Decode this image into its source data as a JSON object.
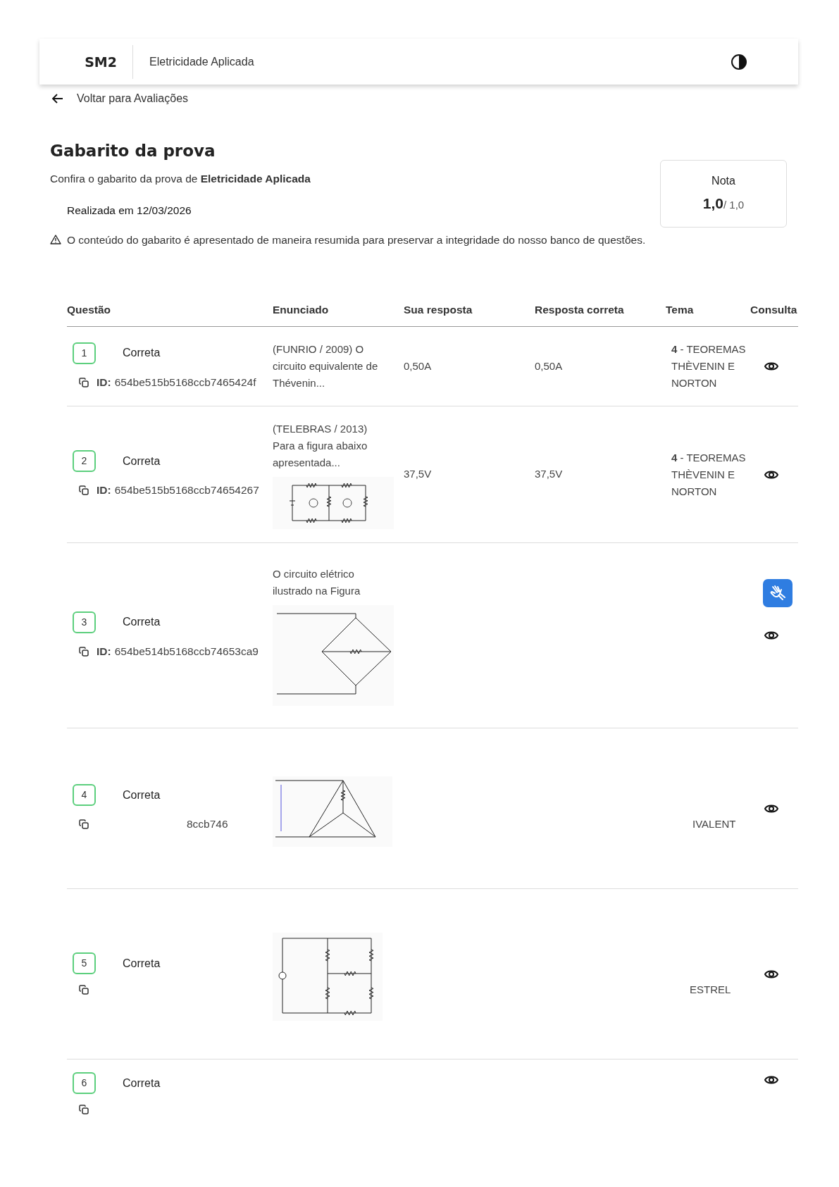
{
  "header": {
    "logo": "SM2",
    "course": "Eletricidade Aplicada"
  },
  "back_link": "Voltar para Avaliações",
  "title": "Gabarito da prova",
  "subtitle": "Confira o gabarito da prova de **Eletricidade Aplicada**",
  "date": "Realizada em 12/03/2026",
  "warning": "O conteúdo do gabarito é apresentado de maneira resumida para preservar a integridade do nosso banco de questões.",
  "grade": {
    "label": "Nota",
    "value": "1,0",
    "max": "/ 1,0"
  },
  "table": {
    "columns": [
      "Questão",
      "Enunciado",
      "Sua resposta",
      "Resposta correta",
      "Tema",
      "Consulta"
    ],
    "rows": [
      {
        "number": "1",
        "status": "Correta",
        "correct": true,
        "id_label": "ID:",
        "id": "654be515b5168ccb7465424f",
        "statement": "(FUNRIO / 2009) O circuito equivalente de Thévenin...",
        "answer": "0,50A",
        "correct_answer": "0,50A",
        "topic": "**4** - TEOREMAS THÈVENIN E NORTON"
      },
      {
        "number": "2",
        "status": "Correta",
        "correct": true,
        "id_label": "ID:",
        "id": "654be515b5168ccb74654267",
        "statement": "(TELEBRAS / 2013) Para a figura abaixo apresentada...",
        "figure": {
          "kind": "two-loop"
        },
        "answer": "37,5V",
        "correct_answer": "37,5V",
        "topic": "**4** - TEOREMAS THÈVENIN E NORTON"
      },
      {
        "number": "3",
        "status": "Correta",
        "correct": true,
        "id_label": "ID:",
        "id": "654be514b5168ccb74653ca9",
        "statement": "O circuito elétrico ilustrado na Figura",
        "figure": {
          "kind": "bridge"
        }
      },
      {
        "number": "4",
        "status": "Correta",
        "correct": true,
        "id": "8ccb746",
        "figure": {
          "kind": "delta-wye"
        },
        "topic": "IVALENT"
      },
      {
        "number": "5",
        "status": "Correta",
        "correct": true,
        "figure": {
          "kind": "ladder"
        },
        "topic": "ESTREL"
      },
      {
        "number": "6",
        "status": "Correta",
        "correct": true
      }
    ]
  }
}
